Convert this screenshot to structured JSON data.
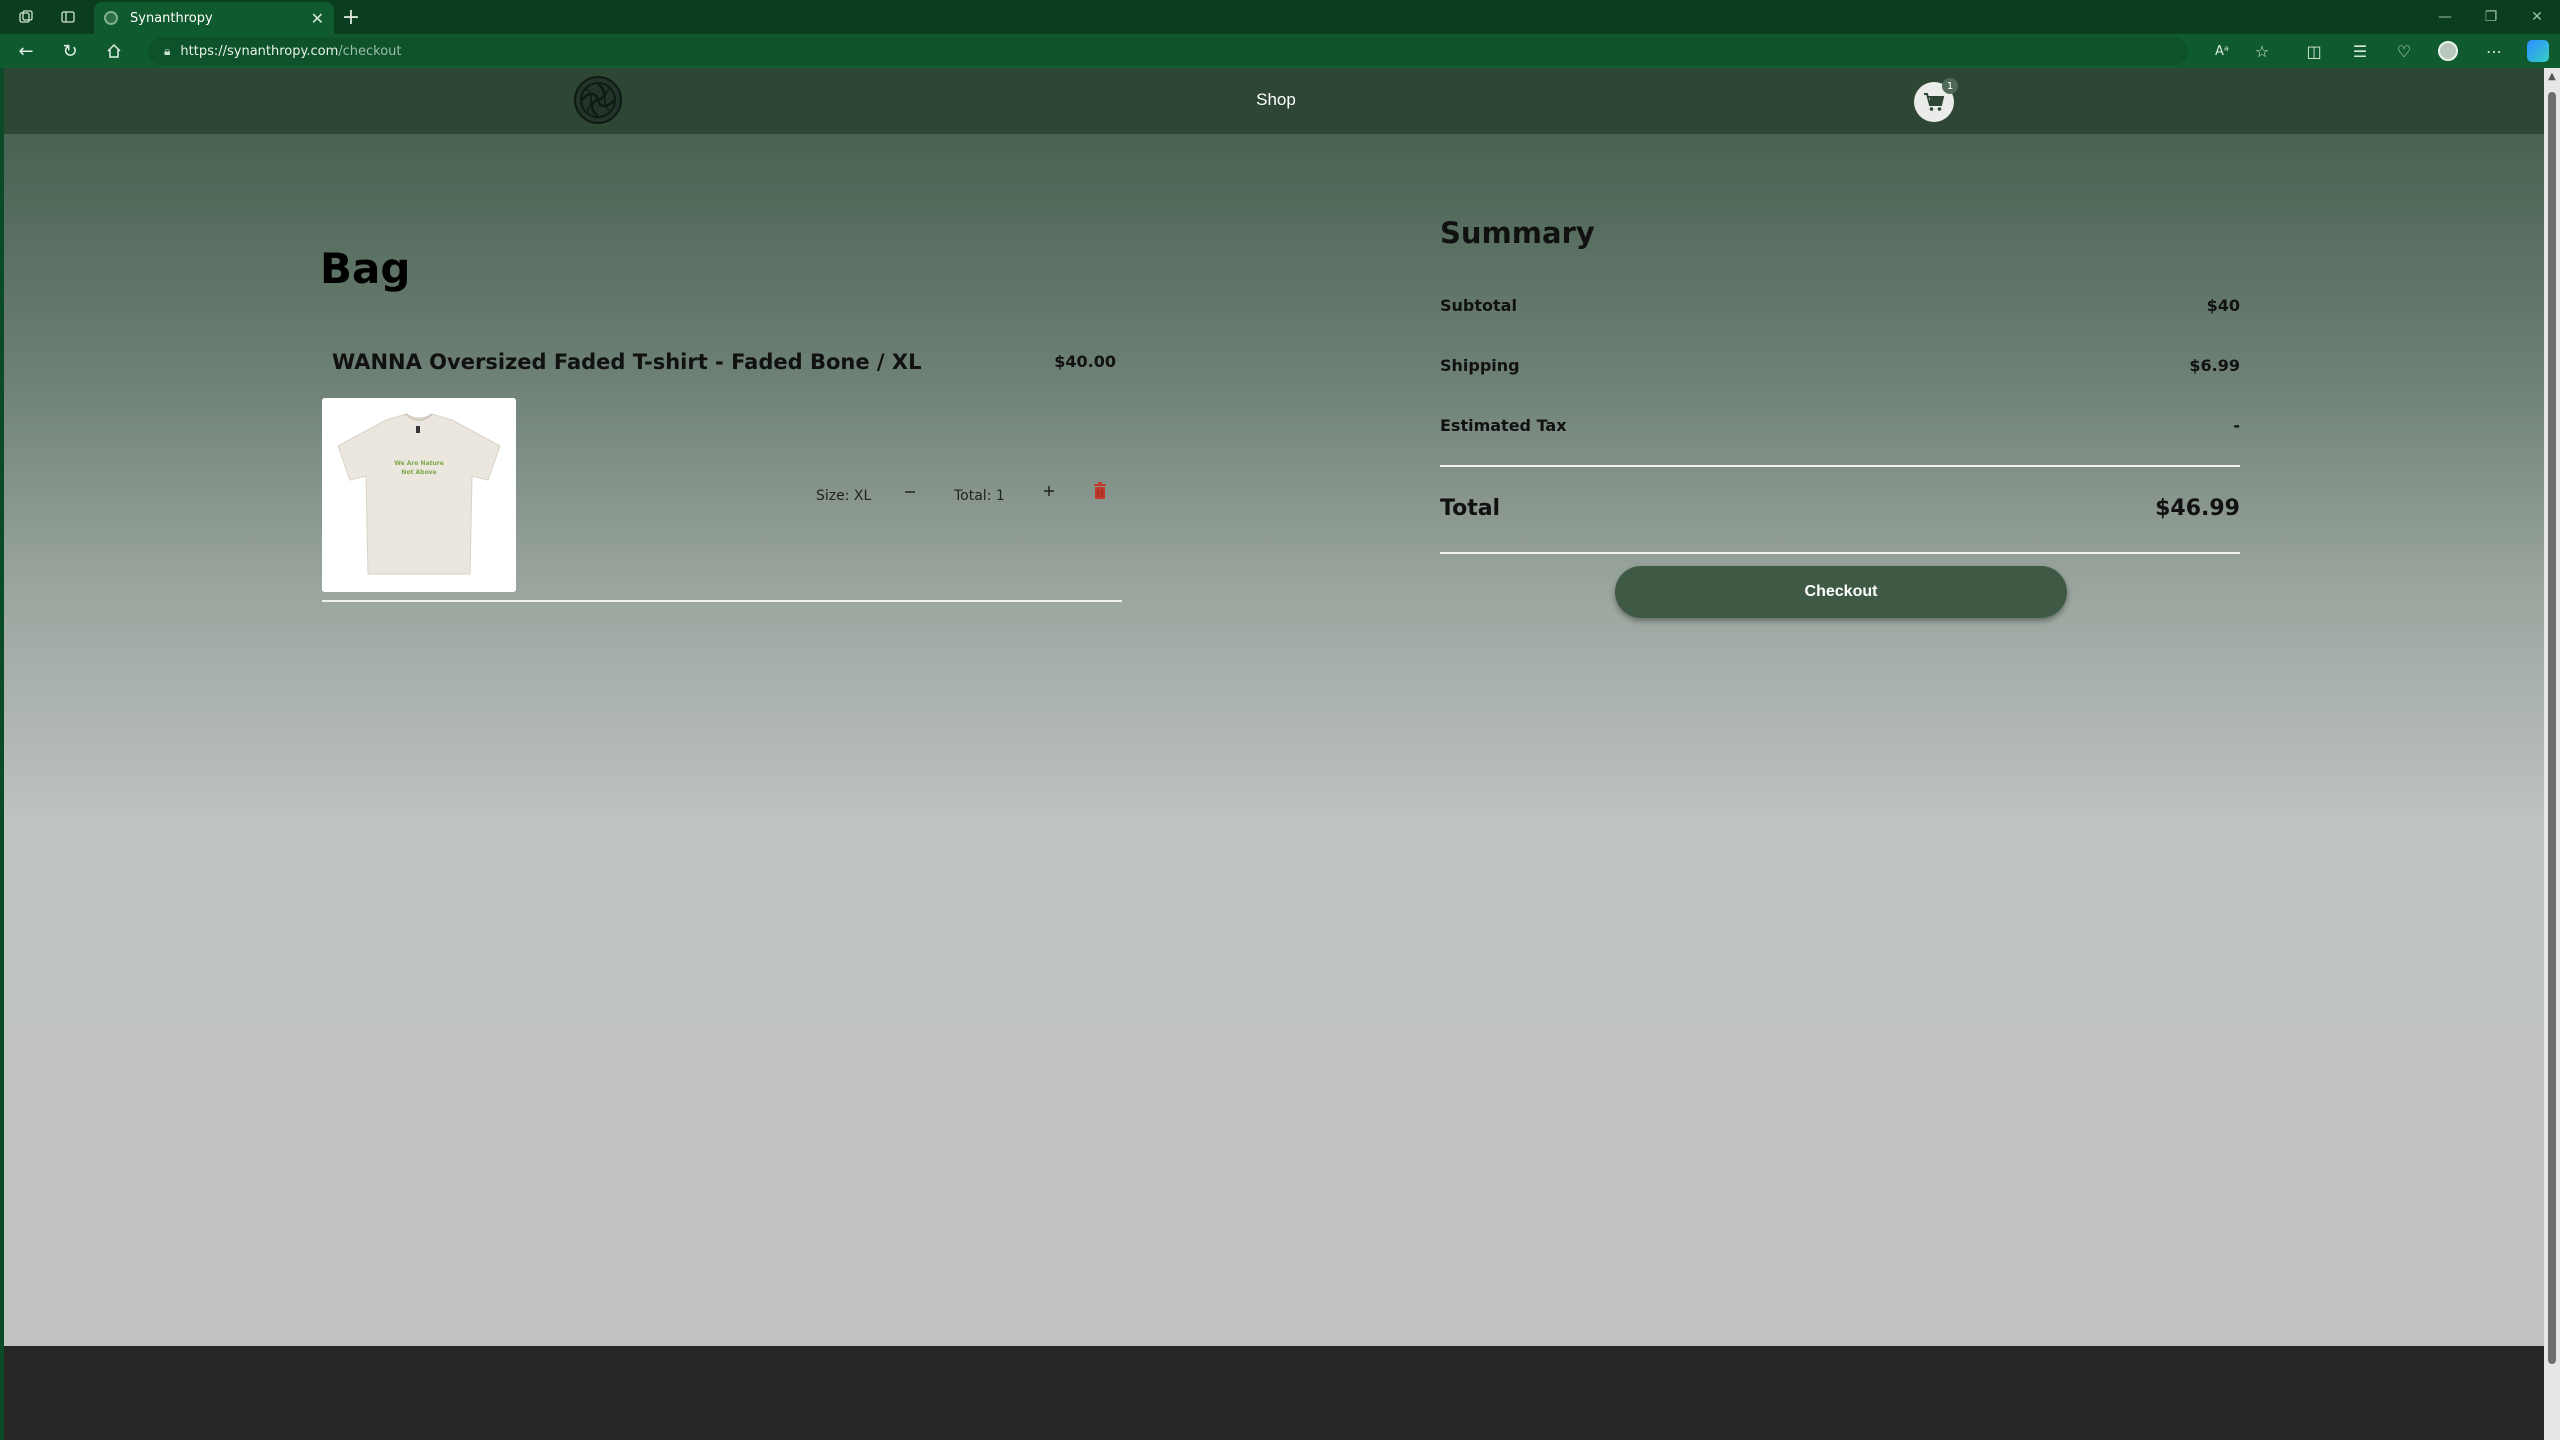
{
  "browser": {
    "tab_title": "Synanthropy",
    "url_host": "https://synanthropy.com",
    "url_path": "/checkout"
  },
  "site": {
    "nav_shop": "Shop",
    "cart_count": "1"
  },
  "bag": {
    "title": "Bag",
    "item": {
      "name": "WANNA Oversized Faded T-shirt - Faded Bone / XL",
      "price": "$40.00",
      "size_label": "Size: XL",
      "quantity_label": "Total: 1",
      "shirt_text": [
        "We Are Nature",
        "Not Above"
      ]
    }
  },
  "summary": {
    "title": "Summary",
    "subtotal_label": "Subtotal",
    "subtotal_value": "$40",
    "shipping_label": "Shipping",
    "shipping_value": "$6.99",
    "tax_label": "Estimated Tax",
    "tax_value": "-",
    "total_label": "Total",
    "total_value": "$46.99",
    "checkout_label": "Checkout"
  },
  "colors": {
    "header": "#2e4735",
    "checkout_button": "#3f5a44",
    "delete_icon": "#c0392b",
    "footer": "#262626"
  },
  "icons": [
    "back-icon",
    "refresh-icon",
    "home-icon",
    "lock-icon",
    "star-icon",
    "cart-icon",
    "trash-icon",
    "minus-icon",
    "plus-icon"
  ]
}
